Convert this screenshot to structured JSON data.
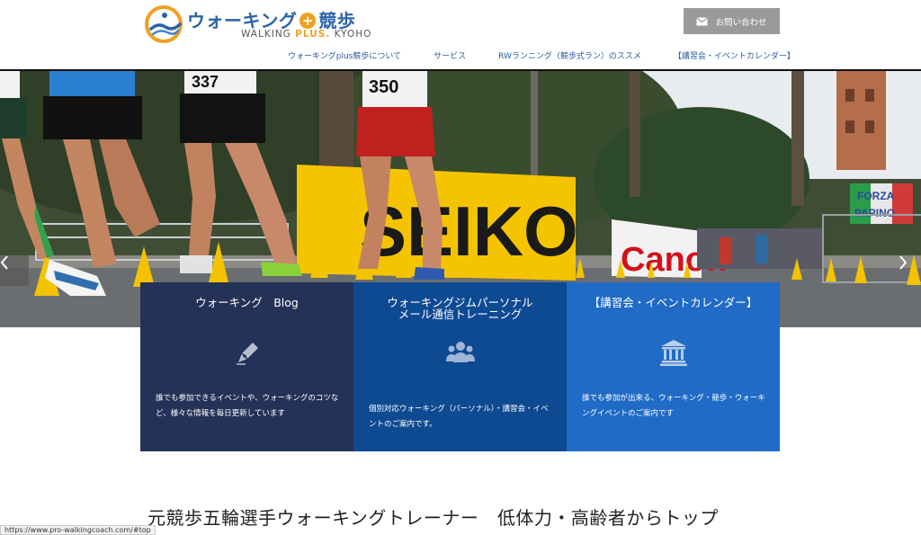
{
  "header": {
    "logo": {
      "title_main": "ウォーキング",
      "title_plus": "+",
      "title_end": "競歩",
      "subtitle_a": "WALKING",
      "subtitle_b": "PLUS.",
      "subtitle_c": "KYOHO"
    },
    "contact_label": "お問い合わせ",
    "nav": [
      {
        "label": "ウォーキングplus競歩について"
      },
      {
        "label": "サービス"
      },
      {
        "label": "RWランニング（競歩式ラン）のススメ"
      },
      {
        "label": "【講習会・イベントカレンダー】"
      }
    ]
  },
  "hero": {
    "bib_numbers": [
      "337",
      "350"
    ],
    "banners": [
      "SEIKO",
      "Canon"
    ],
    "sign_lines": [
      "FORZA",
      "PAPINO"
    ],
    "prev_icon": "chevron-left-icon",
    "next_icon": "chevron-right-icon"
  },
  "features": [
    {
      "title": "ウォーキング　Blog",
      "icon": "pen-icon",
      "text": "誰でも参加できるイベントや、ウォーキングのコツなど、様々な情報を毎日更新しています"
    },
    {
      "title": "ウォーキングジムパーソナル\nメール通信トレーニング",
      "icon": "people-icon",
      "text": "個別対応ウォーキング（パーソナル）・講習会・イベントのご案内です。"
    },
    {
      "title": "【講習会・イベントカレンダー】",
      "icon": "institution-icon",
      "text": "誰でも参加が出来る、ウォーキング・競歩・ウォーキングイベントのご案内です"
    }
  ],
  "tagline": "元競歩五輪選手ウォーキングトレーナー　低体力・高齢者からトップ",
  "status_url": "https://www.pro-walkingcoach.com/#top",
  "colors": {
    "brand_blue": "#2c63a8",
    "brand_orange": "#f0a020",
    "box_dark": "#253257",
    "box_mid": "#0e4a92",
    "box_light": "#1f6bc6"
  }
}
